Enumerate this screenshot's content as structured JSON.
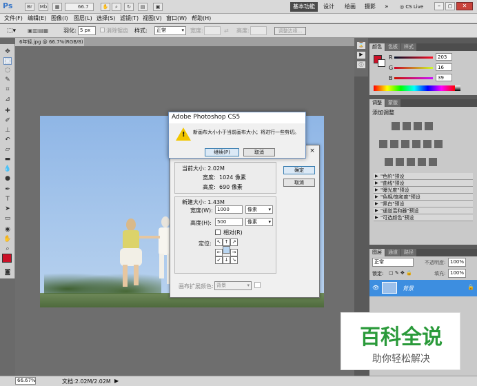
{
  "app": {
    "logo": "Ps",
    "zoom_select": "66.7",
    "workspace_active": "基本功能",
    "workspaces": [
      "设计",
      "绘画",
      "摄影"
    ],
    "more": "»",
    "cs_live": "CS Live"
  },
  "menu": [
    "文件(F)",
    "编辑(E)",
    "图像(I)",
    "图层(L)",
    "选择(S)",
    "滤镜(T)",
    "视图(V)",
    "窗口(W)",
    "帮助(H)"
  ],
  "options": {
    "feather_label": "羽化:",
    "feather_value": "5 px",
    "antialias": "消除锯齿",
    "style_label": "样式:",
    "style_value": "正常",
    "width_label": "宽度:",
    "height_label": "高度:",
    "refine": "调整边缘..."
  },
  "document": {
    "tab": "6年轻.jpg @ 66.7%(RGB/8)",
    "close": "×"
  },
  "status": {
    "zoom": "66.67%",
    "doc": "文档:2.02M/2.02M"
  },
  "color_panel": {
    "tabs": [
      "颜色",
      "色板",
      "样式"
    ],
    "r_label": "R",
    "g_label": "G",
    "b_label": "B",
    "r": "203",
    "g": "16",
    "b": "39",
    "fg_color": "#cb1027"
  },
  "adjust_panel": {
    "tabs": [
      "调整",
      "蒙版"
    ],
    "title": "添加调整",
    "presets": [
      "\"色阶\"预设",
      "\"曲线\"预设",
      "\"曝光度\"预设",
      "\"色相/饱和度\"预设",
      "\"黑白\"预设",
      "\"通道混和器\"预设",
      "\"可选颜色\"预设"
    ]
  },
  "layers_panel": {
    "tabs": [
      "图层",
      "通道",
      "路径"
    ],
    "blend": "正常",
    "opacity_label": "不透明度:",
    "opacity": "100%",
    "lock_label": "锁定:",
    "fill_label": "填充:",
    "fill": "100%",
    "layer_name": "背景"
  },
  "canvas_dialog": {
    "current_size": "当前大小: 2.02M",
    "width_label": "宽度:",
    "width": "1024 像素",
    "height_label": "高度:",
    "height": "690 像素",
    "new_size": "新建大小: 1.43M",
    "w_label": "宽度(W):",
    "w_value": "1000",
    "h_label": "高度(H):",
    "h_value": "500",
    "unit": "像素",
    "relative": "相对(R)",
    "anchor": "定位:",
    "ext_label": "画布扩展颜色:",
    "ext_value": "背景",
    "ok": "确定",
    "cancel": "取消",
    "close": "×"
  },
  "confirm_dialog": {
    "title": "Adobe Photoshop CS5",
    "message": "新画布大小小于当前画布大小；将进行一些剪切。",
    "continue": "继续(P)",
    "cancel": "取消",
    "warn": "!"
  },
  "watermark": {
    "title": "百科全说",
    "subtitle": "助你轻松解决"
  }
}
